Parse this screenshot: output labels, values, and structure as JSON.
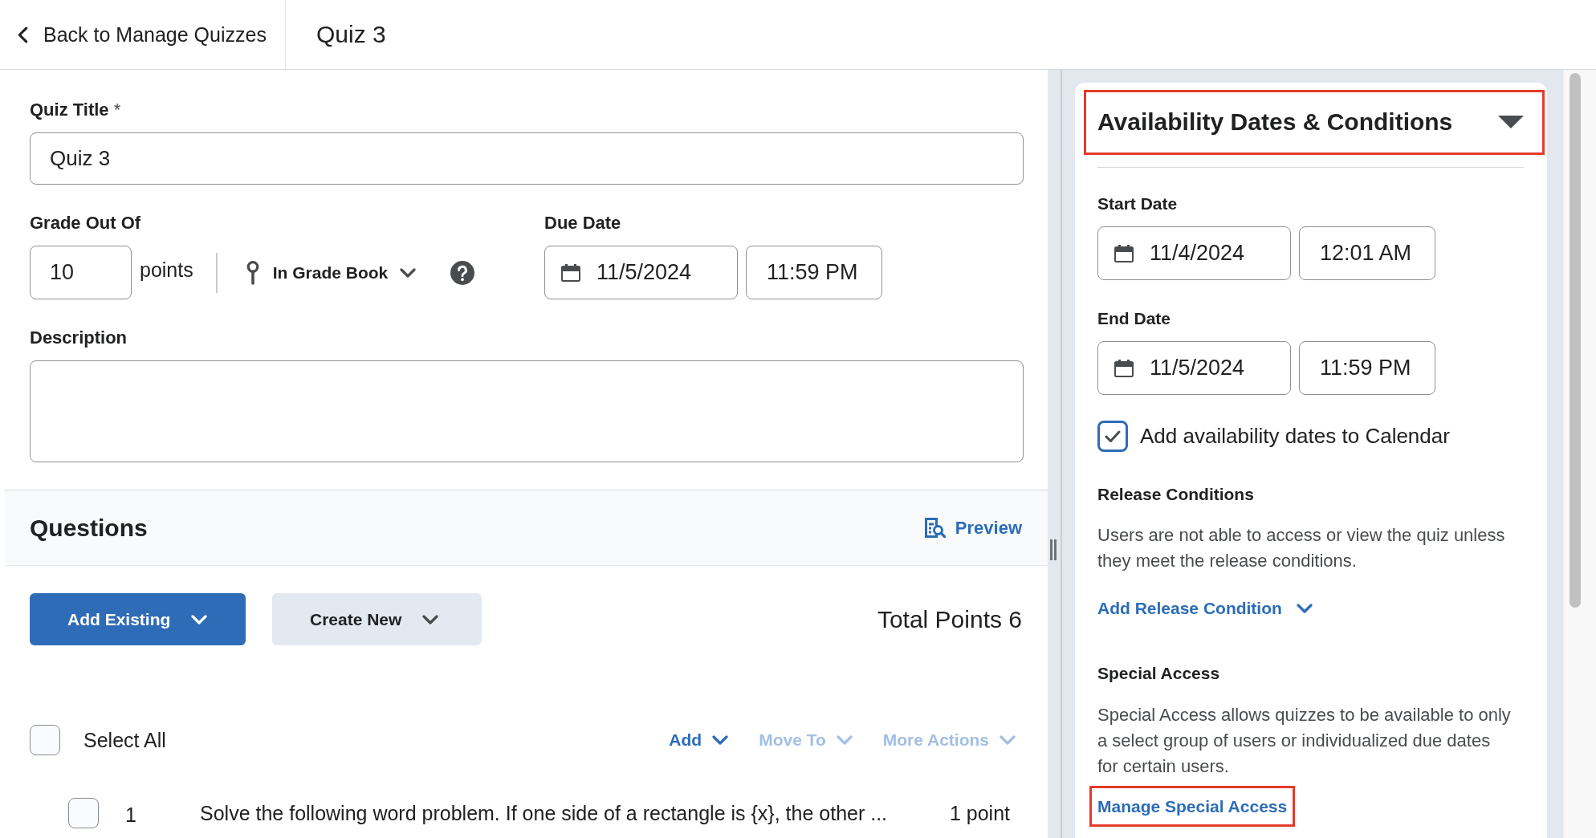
{
  "header": {
    "back_link": "Back to Manage Quizzes",
    "title": "Quiz 3"
  },
  "quiz_title": {
    "label": "Quiz Title",
    "required_mark": "*",
    "value": "Quiz 3"
  },
  "grade": {
    "label": "Grade Out Of",
    "value": "10",
    "unit": "points",
    "grade_book": "In Grade Book"
  },
  "due_date": {
    "label": "Due Date",
    "date": "11/5/2024",
    "time": "11:59 PM"
  },
  "description": {
    "label": "Description"
  },
  "questions": {
    "title": "Questions",
    "preview": "Preview",
    "buttons": [
      {
        "label": "Add Existing",
        "kind": "primary"
      },
      {
        "label": "Create New",
        "kind": "secondary"
      }
    ],
    "total_points": "Total Points 6",
    "select_all": {
      "label": "Select All",
      "checked": false
    },
    "actions": [
      {
        "label": "Add",
        "disabled": false
      },
      {
        "label": "Move To",
        "disabled": true
      },
      {
        "label": "More Actions",
        "disabled": true
      }
    ],
    "rows": [
      {
        "checked": false,
        "number": "1",
        "text": "Solve the following word problem. If one side of a rectangle is {x}, the other ...",
        "points": "1 point"
      }
    ]
  },
  "availability_panel": {
    "title": "Availability Dates & Conditions",
    "expanded": true,
    "highlighted": true,
    "date_ranges": [
      {
        "label": "Start Date",
        "date": "11/4/2024",
        "time": "12:01 AM"
      },
      {
        "label": "End Date",
        "date": "11/5/2024",
        "time": "11:59 PM"
      }
    ],
    "calendar_option": {
      "label": "Add availability dates to Calendar",
      "checked": true
    },
    "release_conditions": {
      "title": "Release Conditions",
      "text": "Users are not able to access or view the quiz unless they meet the release conditions.",
      "link": "Add Release Condition"
    },
    "special_access": {
      "title": "Special Access",
      "text": "Special Access allows quizzes to be available to only a select group of users or individualized due dates for certain users.",
      "link": {
        "label": "Manage Special Access",
        "highlighted": true
      }
    }
  }
}
